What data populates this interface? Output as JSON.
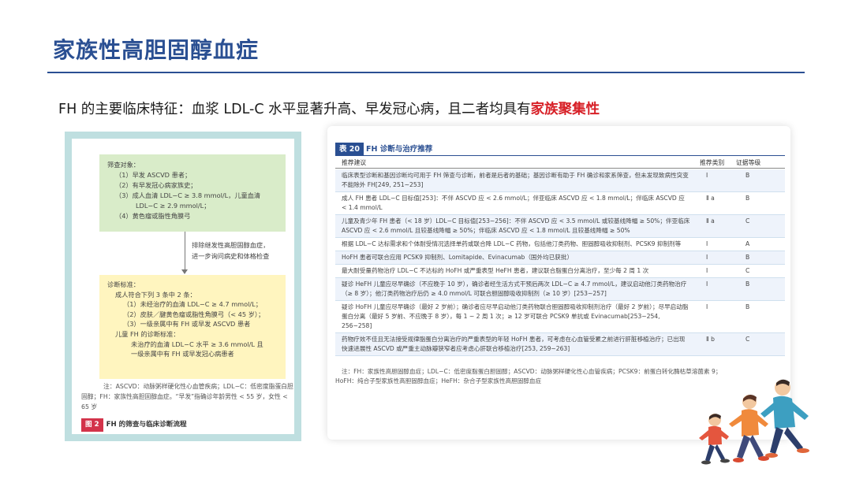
{
  "slide": {
    "title": "家族性高胆固醇血症",
    "headline_main": "FH 的主要临床特征：血浆 LDL-C 水平显著升高、早发冠心病，且二者均具有",
    "headline_highlight": "家族聚集性"
  },
  "figure": {
    "screen": {
      "title": "筛查对象：",
      "items": [
        "（1）早发 ASCVD 患者；",
        "（2）有早发冠心病家族史；",
        "（3）成人血清 LDL−C ≥ 3.8 mmol/L，儿童血清",
        "LDL−C ≥ 2.9 mmol/L；",
        "（4）黄色瘤或脂性角膜弓"
      ]
    },
    "flow_note": [
      "排除继发性高胆固醇血症，",
      "进一步询问病史和体格检查"
    ],
    "criteria": {
      "title": "诊断标准：",
      "adult_title": "成人符合下列 3 条中 2 条：",
      "adult_items": [
        "（1）未经治疗的血清 LDL−C ≥ 4.7 mmol/L；",
        "（2）皮肤／腱黄色瘤或脂性角膜弓（< 45 岁）；",
        "（3）一级亲属中有 FH 或早发 ASCVD 患者"
      ],
      "child_title": "儿童 FH 的诊断标准：",
      "child_items": [
        "未治疗的血清 LDL−C 水平 ≥ 3.6 mmol/L 且",
        "一级亲属中有 FH 或早发冠心病患者"
      ]
    },
    "note": "注：ASCVD：动脉粥样硬化性心血管疾病；LDL−C：低密度脂蛋白胆固醇；FH：家族性高胆固醇血症。“早发”指确诊年龄男性 < 55 岁，女性 < 65 岁",
    "caption_tag": "图 2",
    "caption_text": "FH 的筛查与临床诊断流程"
  },
  "table": {
    "tag": "表 20",
    "title": "FH 诊断与治疗推荐",
    "col_rec": "推荐建议",
    "col_class": "推荐类别",
    "col_level": "证据等级",
    "rows": [
      {
        "rec": "临床表型诊断和基因诊断均可用于 FH 筛查与诊断，前者是后者的基础；基因诊断有助于 FH 确诊和家系筛查，但未发现致病性突变不能除外 FH[249, 251~253]",
        "cls": "I",
        "lvl": "B"
      },
      {
        "rec": "成人 FH 患者 LDL−C 目标值[253]：不伴 ASCVD 应 < 2.6 mmol/L；伴亚临床 ASCVD 应 < 1.8 mmol/L；伴临床 ASCVD 应 < 1.4 mmol/L",
        "cls": "Ⅱ a",
        "lvl": "B"
      },
      {
        "rec": "儿童及青少年 FH 患者（< 18 岁）LDL−C 目标值[253~256]：不伴 ASCVD 应 < 3.5 mmol/L 或较基线降幅 ≥ 50%；伴亚临床 ASCVD 应 < 2.6 mmol/L 且较基线降幅 ≥ 50%；伴临床 ASCVD 应 < 1.8 mmol/L 且较基线降幅 ≥ 50%",
        "cls": "Ⅱ a",
        "lvl": "C"
      },
      {
        "rec": "根据 LDL−C 达标需求和个体耐受情况选择单药或联合降 LDL−C 药物，包括他汀类药物、胆固醇吸收抑制剂、PCSK9 抑制剂等",
        "cls": "I",
        "lvl": "A"
      },
      {
        "rec": "HoFH 患者可联合应用 PCSK9 抑制剂、Lomitapide、Evinacumab（国外均已获批）",
        "cls": "I",
        "lvl": "B"
      },
      {
        "rec": "最大耐受量药物治疗 LDL−C 不达标的 HoFH 或严重表型 HeFH 患者，建议联合脂蛋白分离治疗，至少每 2 周 1 次",
        "cls": "I",
        "lvl": "C"
      },
      {
        "rec": "疑诊 HeFH 儿童应尽早确诊（不应晚于 10 岁），确诊者经生活方式干预后两次 LDL−C ≥ 4.7 mmol/L，建议启动他汀类药物治疗（≥ 8 岁）；他汀类药物治疗后仍 ≥ 4.0 mmol/L 可联合胆固醇吸收抑制剂（≥ 10 岁）[253~257]",
        "cls": "I",
        "lvl": "B"
      },
      {
        "rec": "疑诊 HoFH 儿童应尽早确诊（最好 2 岁前）；确诊者应尽早启动他汀类药物联合胆固醇吸收抑制剂治疗（最好 2 岁前）；尽早启动脂蛋白分离（最好 5 岁前、不应晚于 8 岁），每 1 ~ 2 周 1 次；≥ 12 岁可联合 PCSK9 单抗或 Evinacumab[253~254, 256~258]",
        "cls": "I",
        "lvl": "B"
      },
      {
        "rec": "药物疗效不佳且无法接受规律脂蛋白分离治疗的严重表型的年轻 HoFH 患者，可考虑在心血管受累之前进行肝脏移植治疗；已出现快速进展性 ASCVD 或严重主动脉瓣狭窄者应考虑心肝联合移植治疗[253, 259~263]",
        "cls": "Ⅱ b",
        "lvl": "C"
      }
    ],
    "note_line1": "注：FH：家族性高胆固醇血症；LDL−C：低密度脂蛋白胆固醇；ASCVD：动脉粥样硬化性心血管疾病；PCSK9：前蛋白转化酶枯草溶菌素 9；",
    "note_line2": "HoFH：纯合子型家族性高胆固醇血症；HeFH：杂合子型家族性高胆固醇血症"
  },
  "colors": {
    "accent": "#2a4f92",
    "highlight": "#d71f26",
    "figure_frame": "#bfdfe0",
    "screen_box": "#d9ecc9",
    "criteria_box": "#fff5bf",
    "caption_tag": "#d3334a"
  },
  "decoration": {
    "icon": "running-family-illustration"
  }
}
